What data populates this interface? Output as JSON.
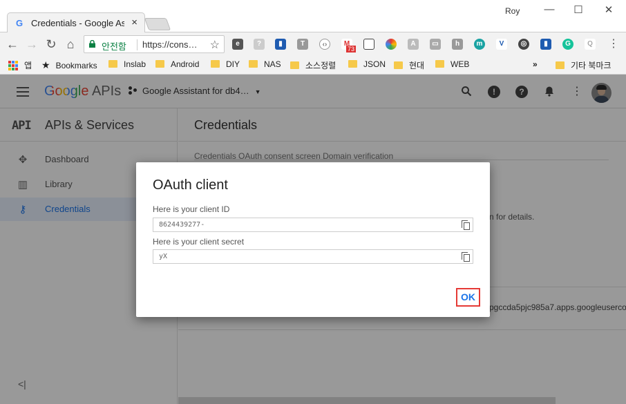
{
  "browser": {
    "tab_title": "Credentials - Google As",
    "window_user": "Roy",
    "secure_label": "안전함",
    "url": "https://cons…",
    "extension_badge": "73",
    "bookmarks": [
      {
        "label": "Bookmarks"
      },
      {
        "label": "Inslab"
      },
      {
        "label": "Android"
      },
      {
        "label": "DIY"
      },
      {
        "label": "NAS"
      },
      {
        "label": "소스정렬"
      },
      {
        "label": "JSON"
      },
      {
        "label": "현대"
      },
      {
        "label": "WEB"
      }
    ],
    "apps_label": "앱",
    "overflow_label": "»",
    "other_bookmarks": "기타 북마크"
  },
  "console": {
    "logo_google": "Google",
    "logo_apis": "APIs",
    "project_name": "Google Assistant for db4…",
    "sidebar_title": "APIs & Services",
    "api_mark": "API",
    "sidebar_items": [
      {
        "label": "Dashboard",
        "icon": "dashboard-icon"
      },
      {
        "label": "Library",
        "icon": "library-icon"
      },
      {
        "label": "Credentials",
        "icon": "key-icon",
        "active": true
      }
    ],
    "collapse_label": "<|",
    "page_title": "Credentials",
    "tabs_text": "Credentials    OAuth consent screen    Domain verification",
    "details_text": "n for details.",
    "client_row_text": "pgccda5pjc985a7.apps.googleuserco"
  },
  "dialog": {
    "title": "OAuth client",
    "client_id_label": "Here is your client ID",
    "client_id_value": "8624439277-",
    "client_secret_label": "Here is your client secret",
    "client_secret_value": "yX",
    "ok_label": "OK"
  },
  "colors": {
    "accent": "#1a73e8",
    "ok_highlight": "#e53935",
    "secure_green": "#0b8043"
  }
}
